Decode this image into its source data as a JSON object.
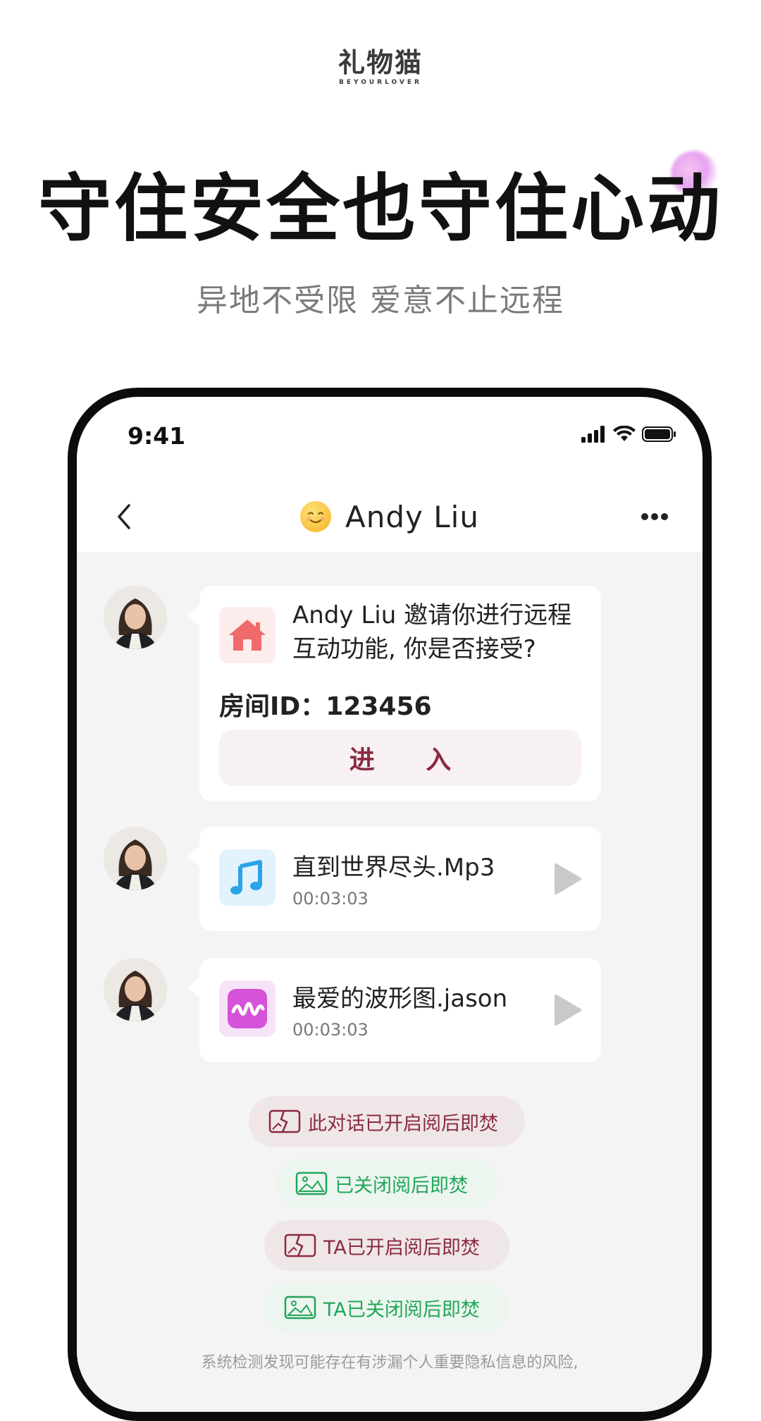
{
  "brand": {
    "name": "礼物猫",
    "tagline": "BEYOURLOVER"
  },
  "headline": "守住安全也守住心动",
  "subline": "异地不受限 爱意不止远程",
  "phone": {
    "status": {
      "time": "9:41"
    },
    "chat_header": {
      "title": "Andy Liu"
    },
    "invite": {
      "text": "Andy Liu 邀请你进行远程互动功能, 你是否接受?",
      "room_id": "房间ID：123456",
      "enter_label": "进 入"
    },
    "files": [
      {
        "name": "直到世界尽头.Mp3",
        "duration": "00:03:03"
      },
      {
        "name": "最爱的波形图.jason",
        "duration": "00:03:03"
      }
    ],
    "system_pills": [
      {
        "text": "此对话已开启阅后即焚",
        "tone": "red"
      },
      {
        "text": "已关闭阅后即焚",
        "tone": "green"
      },
      {
        "text": "TA已开启阅后即焚",
        "tone": "red"
      },
      {
        "text": "TA已关闭阅后即焚",
        "tone": "green"
      }
    ],
    "notice": "系统检测发现可能存在有涉漏个人重要隐私信息的风险,"
  },
  "colors": {
    "accent_red": "#8a2a40",
    "accent_green": "#21a65a",
    "chat_bg": "#f4f4f4"
  },
  "icons": [
    "back-icon",
    "emoji-icon",
    "more-icon",
    "house-icon",
    "music-note-icon",
    "waveform-icon",
    "play-icon",
    "burn-icon",
    "image-icon",
    "signal-icon",
    "wifi-icon",
    "battery-icon"
  ]
}
